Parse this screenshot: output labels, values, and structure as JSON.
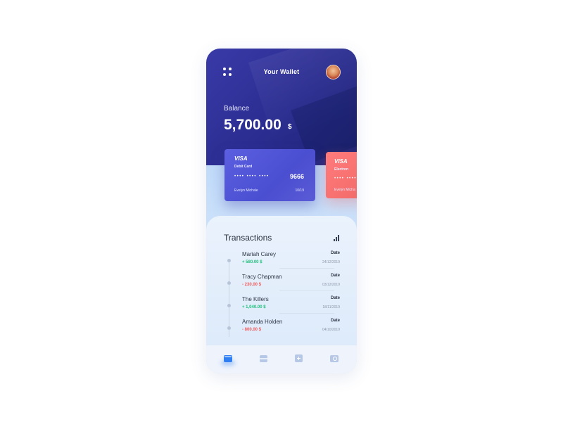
{
  "header": {
    "title": "Your Wallet"
  },
  "balance": {
    "label": "Balance",
    "amount": "5,700.00",
    "currency": "$"
  },
  "cards": [
    {
      "brand": "VISA",
      "type": "Debit Card",
      "masked": "•••• •••• ••••",
      "last4": "9666",
      "holder": "Evelyn Michale",
      "expiry": "10/19"
    },
    {
      "brand": "VISA",
      "type": "Electron",
      "masked": "•••• ••••",
      "holder": "Evelyn Micha"
    }
  ],
  "transactions": {
    "title": "Transactions",
    "items": [
      {
        "name": "Mariah Carey",
        "amount": "+ 580.00 $",
        "date_label": "Date",
        "date": "24/12/2019",
        "direction": "in"
      },
      {
        "name": "Tracy Chapman",
        "amount": "- 230.00 $",
        "date_label": "Date",
        "date": "03/12/2019",
        "direction": "out"
      },
      {
        "name": "The Killers",
        "amount": "+ 1,040.00 $",
        "date_label": "Date",
        "date": "18/11/2019",
        "direction": "in"
      },
      {
        "name": "Amanda Holden",
        "amount": "- 800.00 $",
        "date_label": "Date",
        "date": "04/10/2019",
        "direction": "out"
      }
    ]
  },
  "colors": {
    "income": "#1fbf7a",
    "expense": "#f05a5a",
    "accent": "#2f7ff2"
  },
  "icons": {
    "menu": "grid-dots-icon",
    "avatar": "user-avatar",
    "stats": "bar-chart-icon",
    "nav": [
      "wallet-icon",
      "card-icon",
      "add-icon",
      "search-icon"
    ]
  }
}
